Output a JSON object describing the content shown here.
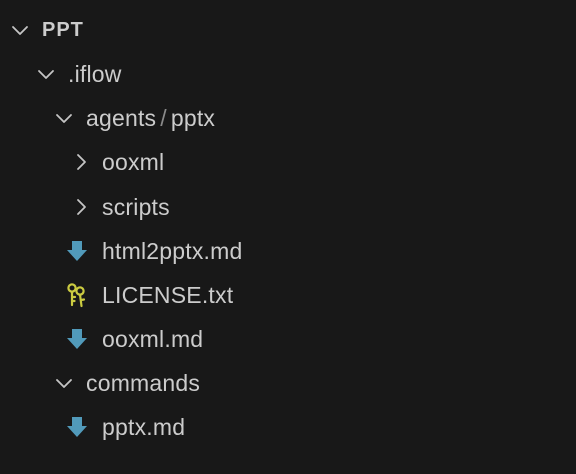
{
  "explorer": {
    "root": {
      "label": "PPT",
      "expanded": true
    },
    "items": [
      {
        "label": ".iflow",
        "kind": "folder",
        "expanded": true
      },
      {
        "label_parts": [
          "agents",
          "pptx"
        ],
        "separator": "/",
        "kind": "folder",
        "expanded": true
      },
      {
        "label": "ooxml",
        "kind": "folder",
        "expanded": false
      },
      {
        "label": "scripts",
        "kind": "folder",
        "expanded": false
      },
      {
        "label": "html2pptx.md",
        "kind": "file",
        "icon": "markdown-down-arrow-icon"
      },
      {
        "label": "LICENSE.txt",
        "kind": "file",
        "icon": "license-key-icon"
      },
      {
        "label": "ooxml.md",
        "kind": "file",
        "icon": "markdown-down-arrow-icon"
      },
      {
        "label": "commands",
        "kind": "folder",
        "expanded": true
      },
      {
        "label": "pptx.md",
        "kind": "file",
        "icon": "markdown-down-arrow-icon"
      }
    ],
    "colors": {
      "background": "#181818",
      "text": "#cccccc",
      "chevron": "#c5c5c5",
      "markdown_icon": "#519aba",
      "license_icon": "#cbcb41"
    }
  }
}
